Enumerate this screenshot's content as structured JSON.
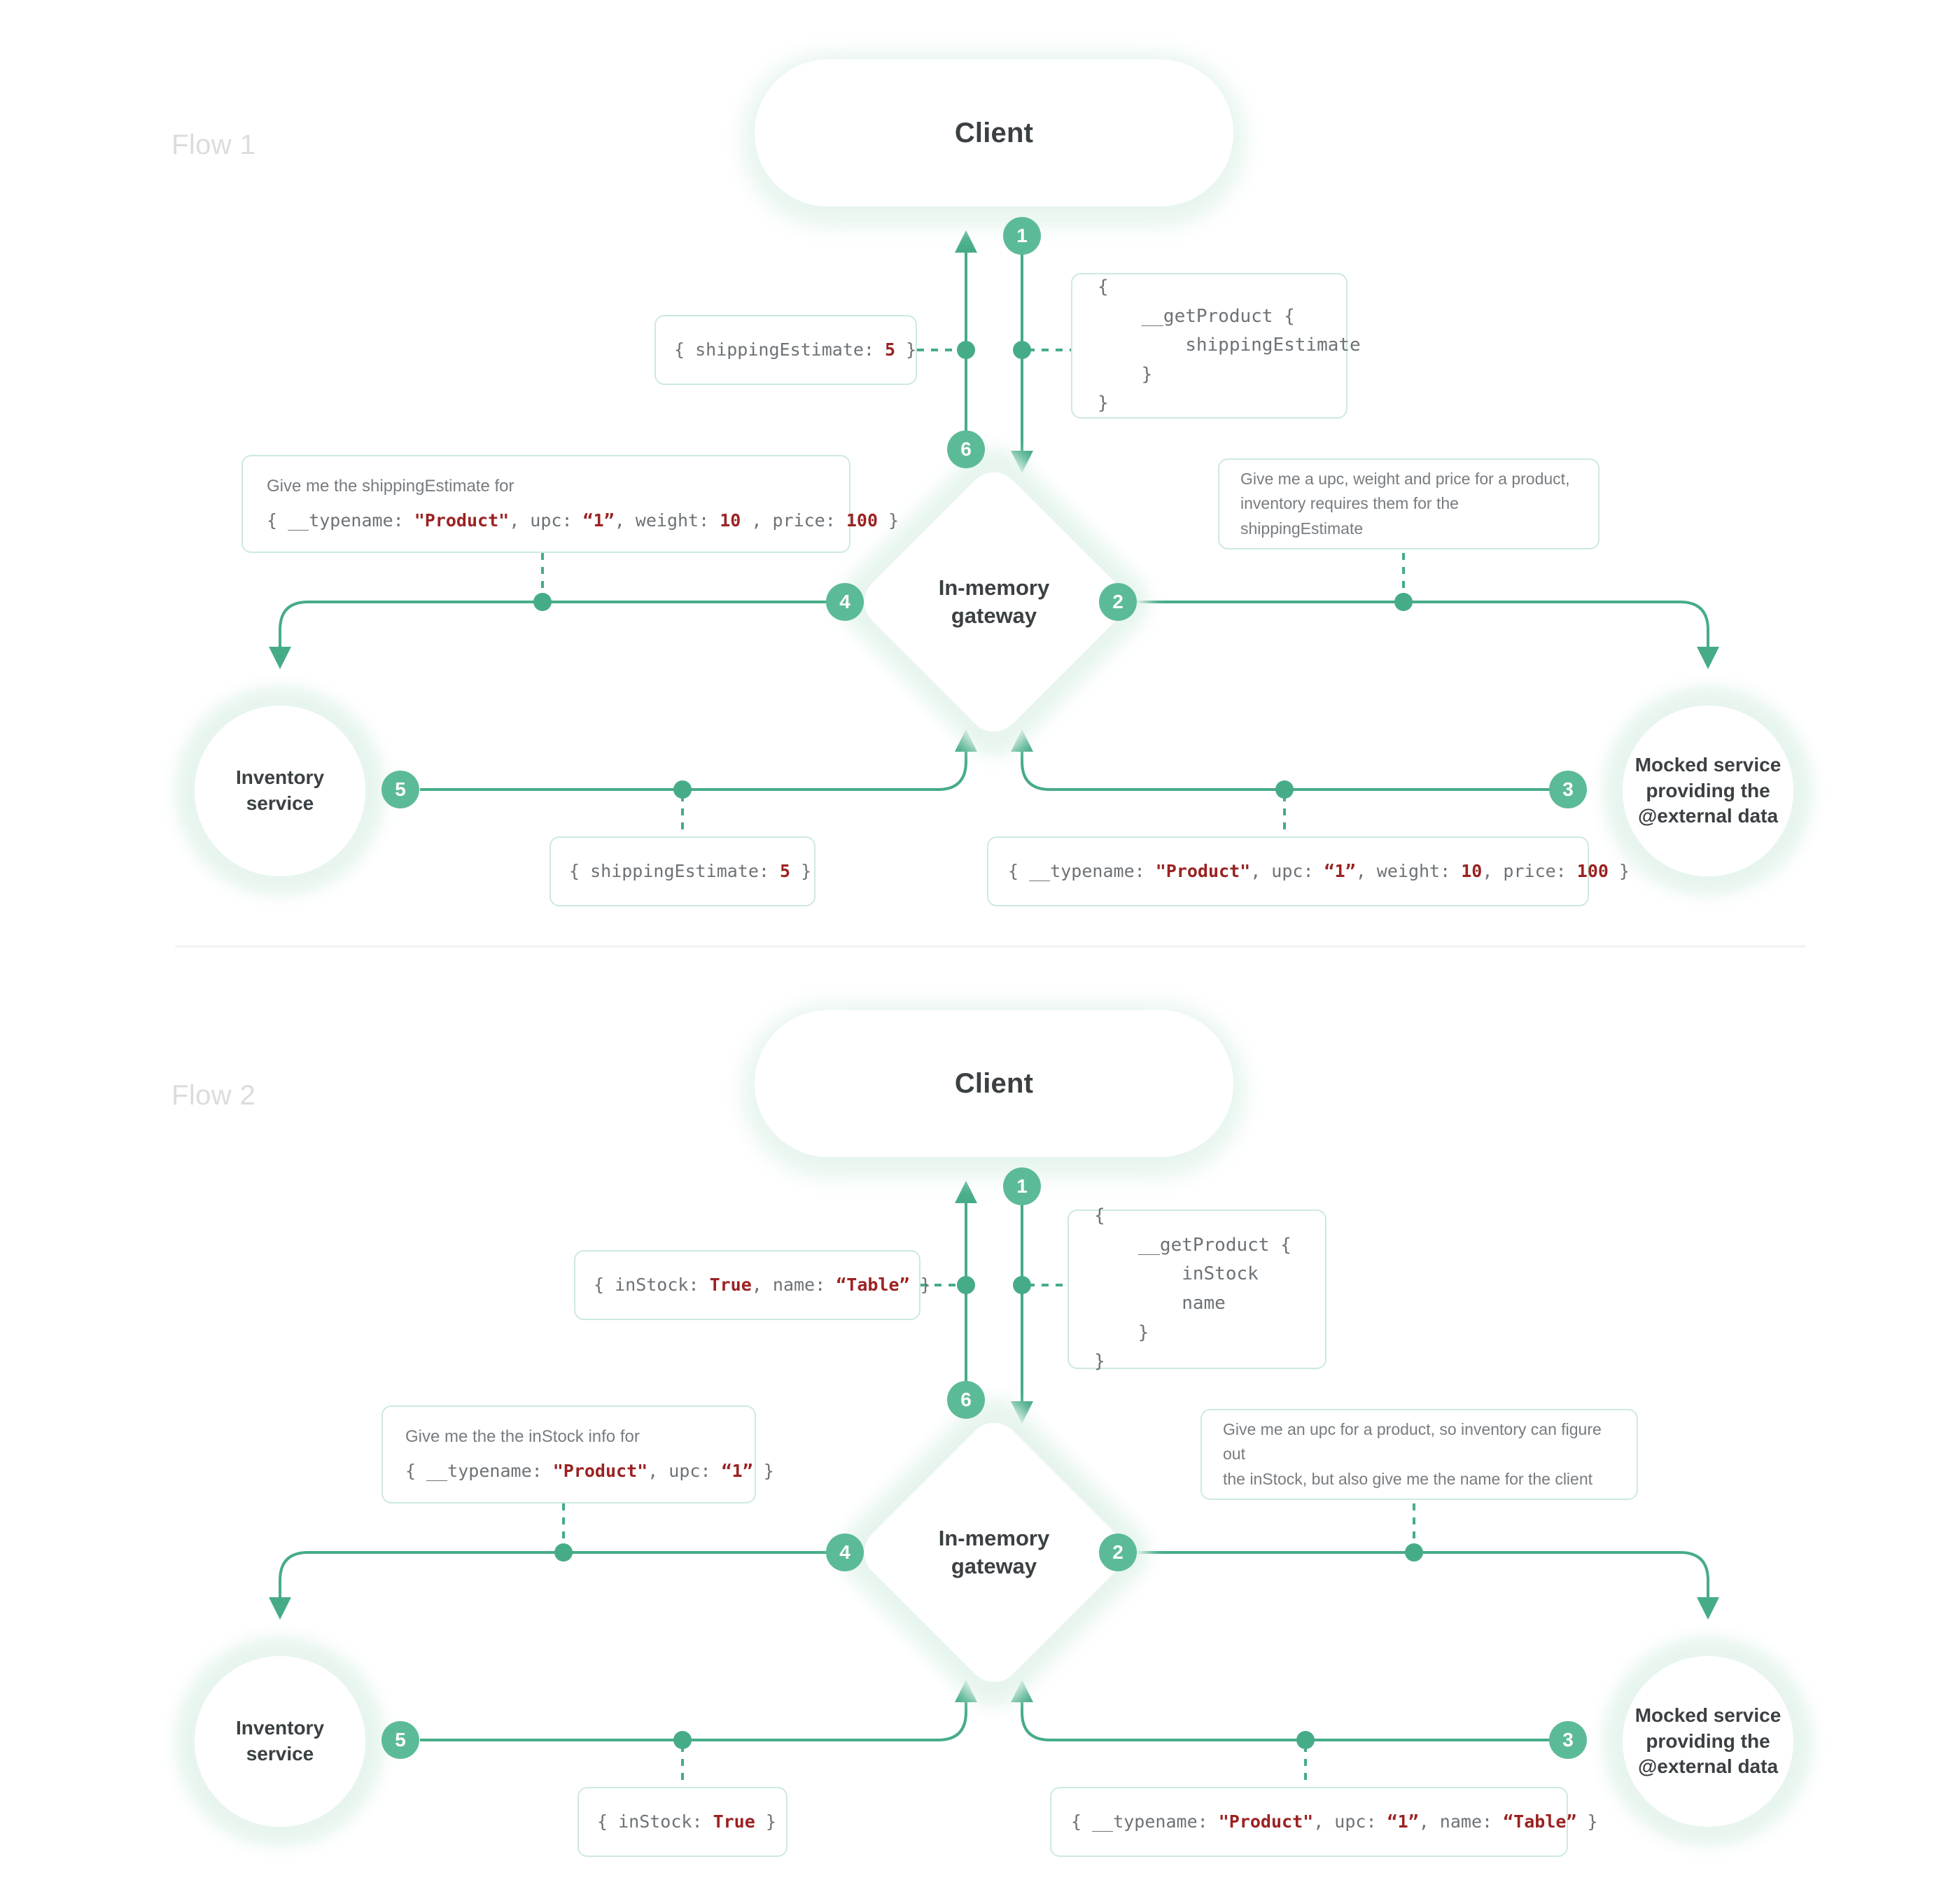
{
  "theme": {
    "accent": "#5cbb97",
    "glow": "#e7f5ee",
    "border": "#cdeadb",
    "code_text": "#6d7276",
    "value_red": "#9b2222",
    "label_gray": "#dcdcdc",
    "divider": "#f2f5f4"
  },
  "flows": [
    {
      "label": "Flow 1",
      "client": "Client",
      "gateway_line1": "In-memory",
      "gateway_line2": "gateway",
      "inventory_line1": "Inventory",
      "inventory_line2": "service",
      "mocked_line1": "Mocked service",
      "mocked_line2": "providing the",
      "mocked_line3": "@external data",
      "steps": [
        "1",
        "2",
        "3",
        "4",
        "5",
        "6"
      ],
      "client_response": "{ shippingEstimate: 5 }",
      "client_response_value": "5",
      "query_block": "{\n    __getProduct {\n        shippingEstimate\n    }\n}",
      "left_note_title": "Give me the shippingEstimate for",
      "left_note_code_pre": "{ __typename: ",
      "left_note_code": "{ __typename: \"Product\", upc: “1”, weight: 10 , price: 100 }",
      "right_note_line1": "Give me a upc, weight and price for a product,",
      "right_note_line2": "inventory requires them for the shippingEstimate",
      "bottom_left_code": "{ shippingEstimate: 5 }",
      "bottom_right_code": "{ __typename: \"Product\", upc: “1”, weight: 10, price: 100 }"
    },
    {
      "label": "Flow 2",
      "client": "Client",
      "gateway_line1": "In-memory",
      "gateway_line2": "gateway",
      "inventory_line1": "Inventory",
      "inventory_line2": "service",
      "mocked_line1": "Mocked service",
      "mocked_line2": "providing the",
      "mocked_line3": "@external data",
      "steps": [
        "1",
        "2",
        "3",
        "4",
        "5",
        "6"
      ],
      "client_response": "{ inStock: True, name: “Table” }",
      "query_block": "{\n    __getProduct {\n        inStock\n        name\n    }\n}",
      "left_note_title": "Give me the the inStock info for",
      "left_note_code": "{ __typename: \"Product\", upc: “1” }",
      "right_note_line1": "Give me an upc for a product, so inventory can figure out",
      "right_note_line2": "the inStock, but also give me the name for the client",
      "bottom_left_code": "{ inStock: True }",
      "bottom_right_code": "{ __typename: \"Product\", upc: “1”, name: “Table” }"
    }
  ]
}
